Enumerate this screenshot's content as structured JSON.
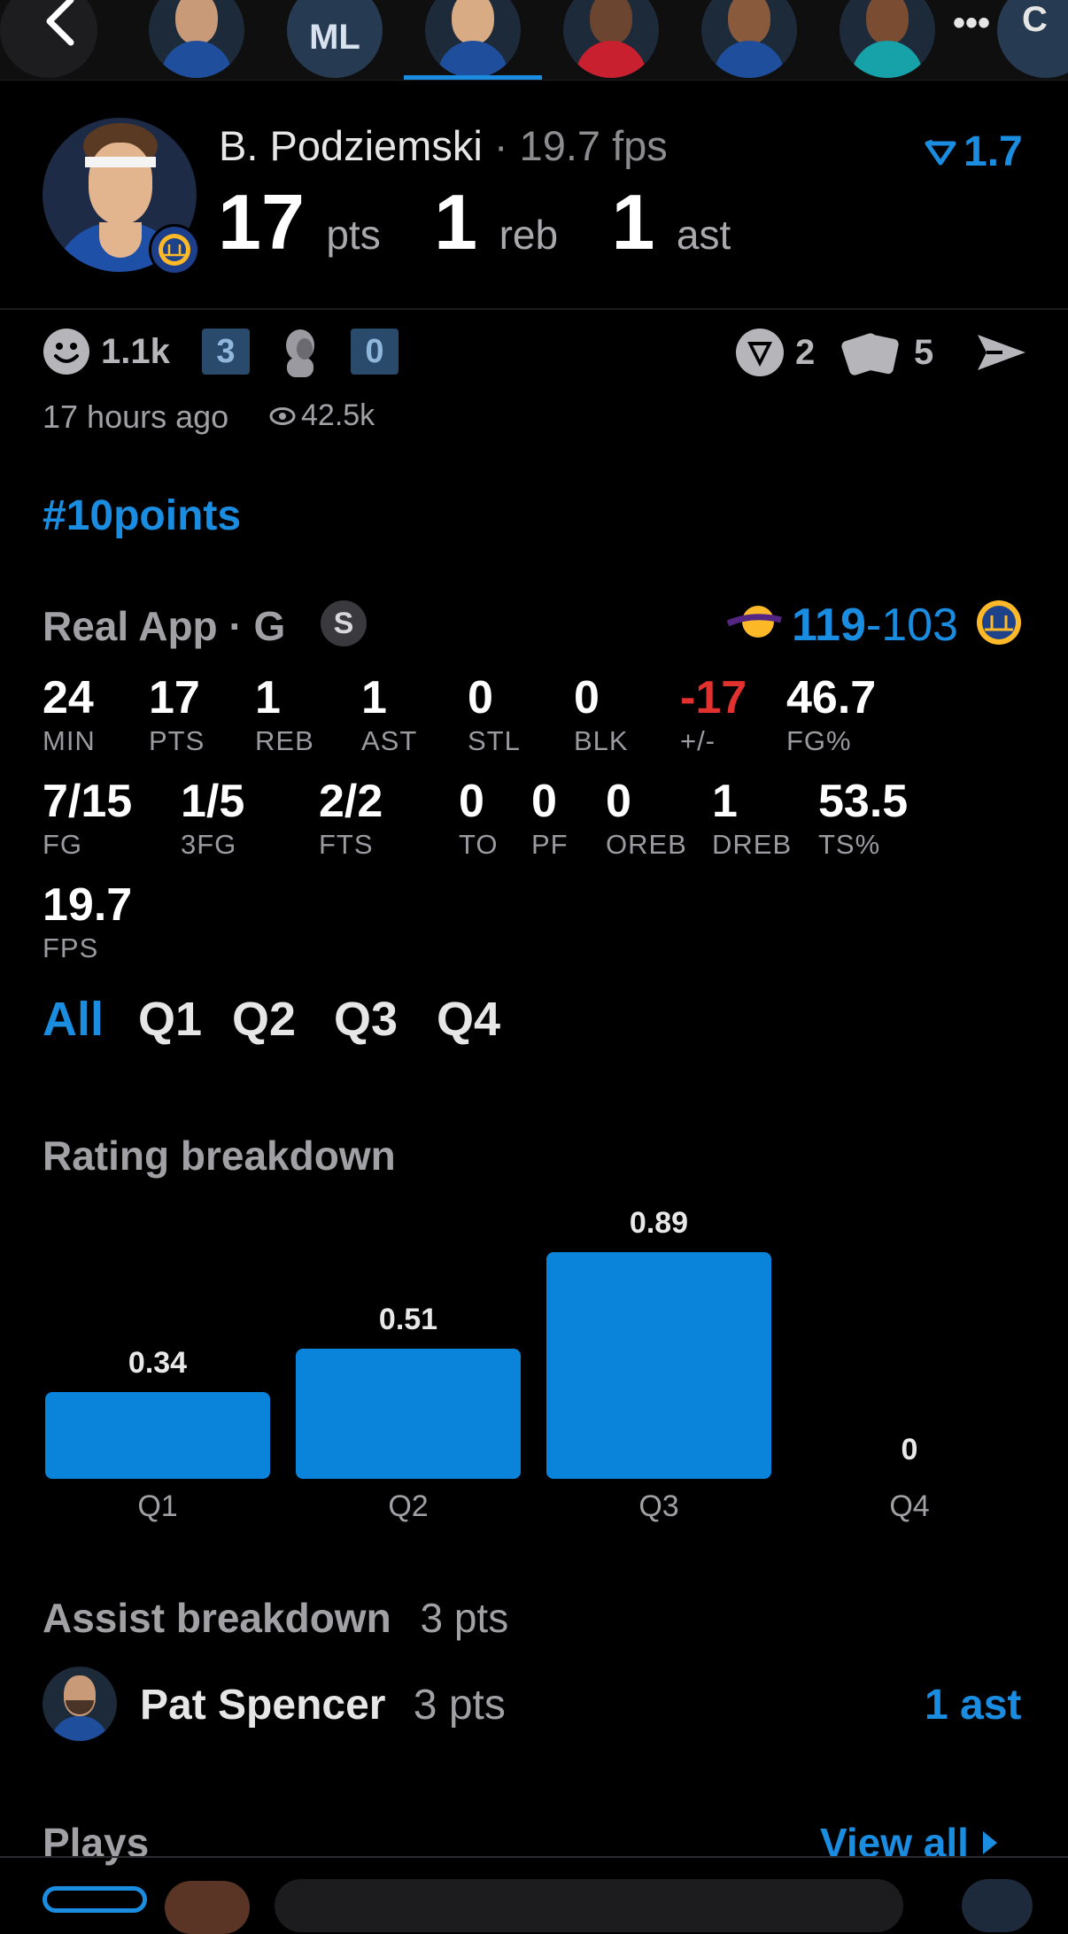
{
  "top_strip": {
    "avatar_initials": "ML",
    "more_label": "•••",
    "edge_letter": "C"
  },
  "player": {
    "name": "B. Podziemski",
    "fps_label": "· 19.7 fps",
    "rating_value": "1.7",
    "pts": "17",
    "pts_unit": "pts",
    "reb": "1",
    "reb_unit": "reb",
    "ast": "1",
    "ast_unit": "ast"
  },
  "reactions": {
    "smile_count": "1.1k",
    "badge_a": "3",
    "badge_b": "0",
    "tags_count": "2",
    "cards_count": "5",
    "time_ago": "17 hours ago",
    "views": "42.5k"
  },
  "hashtag": "#10points",
  "game": {
    "source": "Real App · G",
    "source_badge": "S",
    "score_home": "119",
    "score_sep": "-",
    "score_away": "103"
  },
  "stats": [
    {
      "v": "24",
      "l": "MIN"
    },
    {
      "v": "17",
      "l": "PTS"
    },
    {
      "v": "1",
      "l": "REB"
    },
    {
      "v": "1",
      "l": "AST"
    },
    {
      "v": "0",
      "l": "STL"
    },
    {
      "v": "0",
      "l": "BLK"
    },
    {
      "v": "-17",
      "l": "+/-"
    },
    {
      "v": "46.7",
      "l": "FG%"
    },
    {
      "v": "7/15",
      "l": "FG"
    },
    {
      "v": "1/5",
      "l": "3FG"
    },
    {
      "v": "2/2",
      "l": "FTS"
    },
    {
      "v": "0",
      "l": "TO"
    },
    {
      "v": "0",
      "l": "PF"
    },
    {
      "v": "0",
      "l": "OREB"
    },
    {
      "v": "1",
      "l": "DREB"
    },
    {
      "v": "53.5",
      "l": "TS%"
    },
    {
      "v": "19.7",
      "l": "FPS"
    }
  ],
  "quarter_tabs": [
    "All",
    "Q1",
    "Q2",
    "Q3",
    "Q4"
  ],
  "rating_breakdown_title": "Rating breakdown",
  "chart_data": {
    "type": "bar",
    "categories": [
      "Q1",
      "Q2",
      "Q3",
      "Q4"
    ],
    "values": [
      0.34,
      0.51,
      0.89,
      0
    ],
    "data_labels": [
      "0.34",
      "0.51",
      "0.89",
      "0"
    ],
    "color": "#0a84db"
  },
  "assist": {
    "title": "Assist breakdown",
    "title_pts": "3 pts",
    "name": "Pat Spencer",
    "pts": "3 pts",
    "ast": "1 ast"
  },
  "plays": {
    "title": "Plays",
    "view_all": "View all"
  },
  "colors": {
    "accent": "#1a8de0",
    "negative": "#e2312e",
    "background": "#000000"
  }
}
